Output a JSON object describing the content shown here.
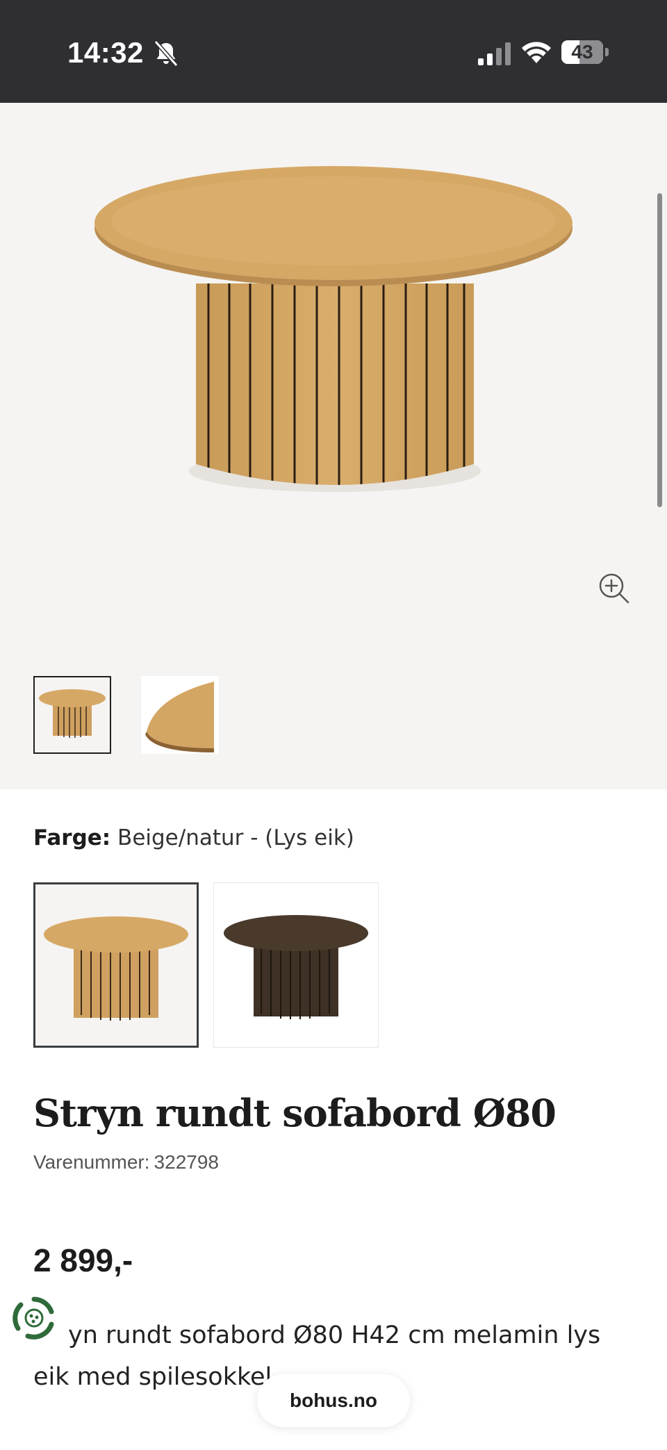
{
  "status_bar": {
    "time": "14:32",
    "battery_level": "43"
  },
  "gallery": {
    "thumbnails": [
      "table-front",
      "table-top-edge"
    ],
    "selected_thumbnail": 0
  },
  "product": {
    "color_label": "Farge:",
    "color_value": "Beige/natur - (Lys eik)",
    "swatches": [
      "light-oak",
      "dark-brown"
    ],
    "selected_swatch": 0,
    "title": "Stryn rundt sofabord Ø80",
    "sku_label": "Varenummer:",
    "sku_value": "322798",
    "price": "2 899,-",
    "description": "yn rundt sofabord Ø80 H42 cm melamin lys eik med spilesokkel"
  },
  "browser": {
    "domain": "bohus.no"
  },
  "colors": {
    "status_bar_bg": "#2f2f33",
    "gallery_bg": "#f5f4f2",
    "oak": "#d5a865",
    "dark_wood": "#4a3a2c"
  }
}
